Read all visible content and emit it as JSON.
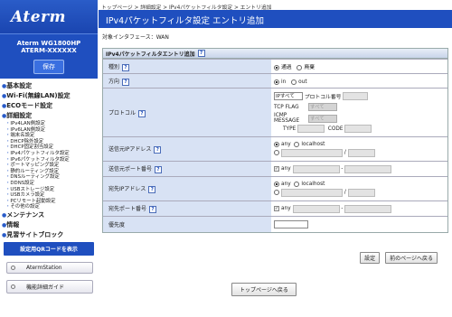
{
  "logo": "Aterm",
  "model": {
    "line1": "Aterm WG1800HP",
    "line2": "ATERM-XXXXXX"
  },
  "save_label": "保存",
  "nav": [
    {
      "label": "基本設定",
      "subs": []
    },
    {
      "label": "Wi-Fi(無線LAN)設定",
      "subs": []
    },
    {
      "label": "ECOモード設定",
      "subs": []
    },
    {
      "label": "詳細設定",
      "subs": [
        "IPv4LAN側設定",
        "IPv6LAN側設定",
        "端末名設定",
        "DHCP除外設定",
        "DHCP固定割当設定",
        "IPv4パケットフィルタ設定",
        "IPv6パケットフィルタ設定",
        "ポートマッピング設定",
        "静的ルーティング設定",
        "DNSルーティング設定",
        "DDNS設定",
        "USBストレージ設定",
        "USBカメラ設定",
        "PCリモート起動設定",
        "その他の設定"
      ]
    },
    {
      "label": "メンテナンス",
      "subs": []
    },
    {
      "label": "情報",
      "subs": []
    },
    {
      "label": "見習サイトブロック",
      "subs": []
    }
  ],
  "qr_button": "設定用QRコードを表示",
  "side_buttons": [
    "AtermStation",
    "機能詳細ガイド"
  ],
  "breadcrumb": "トップページ > 詳細設定 > IPv4パケットフィルタ設定 > エントリ追加",
  "page_title": "IPv4パケットフィルタ設定 エントリ追加",
  "interface_label": "対象インタフェース：WAN",
  "section_title": "IPv4パケットフィルタエントリ追加",
  "help": "?",
  "form": {
    "type": {
      "label": "種別",
      "opt1": "通過",
      "opt2": "廃棄"
    },
    "direction": {
      "label": "方向",
      "opt1": "in",
      "opt2": "out"
    },
    "protocol": {
      "label": "プロトコル",
      "select": "IPすべて",
      "num_label": "プロトコル番号",
      "tcp_flag": "TCP FLAG",
      "tcp_value": "すべて",
      "icmp_message": "ICMP MESSAGE",
      "icmp_value": "すべて",
      "type_label": "TYPE",
      "code_label": "CODE"
    },
    "src_ip": {
      "label": "送信元IPアドレス",
      "any": "any",
      "localhost": "localhost",
      "slash": "/"
    },
    "src_port": {
      "label": "送信元ポート番号",
      "any": "any",
      "dash": "-"
    },
    "dst_ip": {
      "label": "宛先IPアドレス",
      "any": "any",
      "localhost": "localhost",
      "slash": "/"
    },
    "dst_port": {
      "label": "宛先ポート番号",
      "any": "any",
      "dash": "-"
    },
    "priority": {
      "label": "優先度"
    }
  },
  "buttons": {
    "set": "設定",
    "back": "前のページへ戻る",
    "top": "トップページへ戻る"
  }
}
